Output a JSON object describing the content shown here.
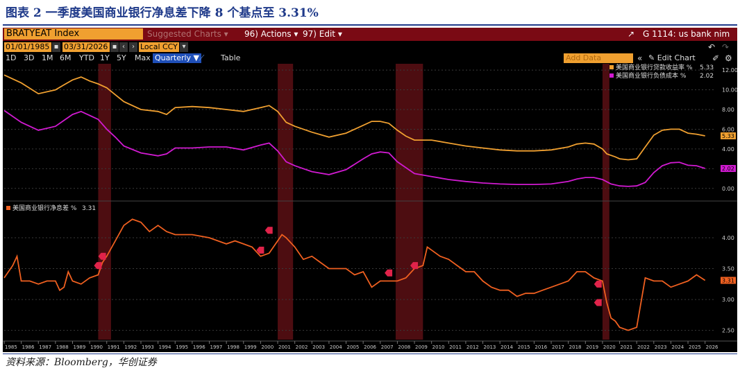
{
  "title": "图表 2  一季度美国商业银行净息差下降 8 个基点至 3.31%",
  "source": "资料来源：Bloomberg，华创证券",
  "terminal": {
    "ticker": "BRATYEAT Index",
    "suggested": "Suggested Charts",
    "actions": "96) Actions",
    "edit": "97) Edit",
    "chart_ref": "G 1114: us bank nim",
    "date_from": "01/01/1985",
    "date_to": "03/31/2026",
    "currency": "Local CCY",
    "periods": [
      "1D",
      "3D",
      "1M",
      "6M",
      "YTD",
      "1Y",
      "5Y",
      "Max"
    ],
    "frequency": "Quarterly",
    "table_label": "Table",
    "add_data": "Add Data",
    "edit_chart": "Edit Chart",
    "colors": {
      "accent": "#f0a030",
      "header": "#7a0a14",
      "freq": "#1f4fb8"
    }
  },
  "chart_data": [
    {
      "type": "line",
      "panel": "upper",
      "ylim": [
        -1.0,
        12.5
      ],
      "yticks": [
        "12.00",
        "10.00",
        "8.00",
        "6.00",
        "4.00",
        "2.00",
        "0.00"
      ],
      "ytick_values": [
        12,
        10,
        8,
        6,
        4,
        2,
        0
      ],
      "series": [
        {
          "name": "美国商业银行贷款收益率 %",
          "last": "5.33",
          "color": "#f0a030",
          "points": [
            [
              1985.0,
              11.5
            ],
            [
              1986.0,
              10.7
            ],
            [
              1987.0,
              9.6
            ],
            [
              1988.0,
              10.0
            ],
            [
              1988.5,
              10.5
            ],
            [
              1989.0,
              11.0
            ],
            [
              1989.5,
              11.3
            ],
            [
              1990.0,
              10.9
            ],
            [
              1990.5,
              10.6
            ],
            [
              1991.0,
              10.2
            ],
            [
              1991.5,
              9.5
            ],
            [
              1992.0,
              8.8
            ],
            [
              1993.0,
              8.0
            ],
            [
              1994.0,
              7.8
            ],
            [
              1994.5,
              7.5
            ],
            [
              1995.0,
              8.2
            ],
            [
              1996.0,
              8.3
            ],
            [
              1997.0,
              8.2
            ],
            [
              1998.0,
              8.0
            ],
            [
              1999.0,
              7.8
            ],
            [
              2000.0,
              8.2
            ],
            [
              2000.5,
              8.4
            ],
            [
              2001.0,
              7.8
            ],
            [
              2001.5,
              6.7
            ],
            [
              2002.0,
              6.3
            ],
            [
              2003.0,
              5.7
            ],
            [
              2004.0,
              5.2
            ],
            [
              2005.0,
              5.6
            ],
            [
              2006.0,
              6.4
            ],
            [
              2006.5,
              6.8
            ],
            [
              2007.0,
              6.8
            ],
            [
              2007.5,
              6.6
            ],
            [
              2008.0,
              5.9
            ],
            [
              2008.5,
              5.3
            ],
            [
              2009.0,
              4.9
            ],
            [
              2010.0,
              4.9
            ],
            [
              2011.0,
              4.6
            ],
            [
              2012.0,
              4.3
            ],
            [
              2013.0,
              4.1
            ],
            [
              2014.0,
              3.9
            ],
            [
              2015.0,
              3.8
            ],
            [
              2016.0,
              3.8
            ],
            [
              2017.0,
              3.9
            ],
            [
              2018.0,
              4.2
            ],
            [
              2018.5,
              4.5
            ],
            [
              2019.0,
              4.6
            ],
            [
              2019.5,
              4.5
            ],
            [
              2020.0,
              4.0
            ],
            [
              2020.25,
              3.5
            ],
            [
              2020.75,
              3.2
            ],
            [
              2021.0,
              3.0
            ],
            [
              2021.5,
              2.9
            ],
            [
              2022.0,
              3.0
            ],
            [
              2022.5,
              4.2
            ],
            [
              2023.0,
              5.4
            ],
            [
              2023.5,
              5.9
            ],
            [
              2024.0,
              6.0
            ],
            [
              2024.5,
              6.0
            ],
            [
              2025.0,
              5.6
            ],
            [
              2025.5,
              5.5
            ],
            [
              2026.0,
              5.33
            ]
          ]
        },
        {
          "name": "美国商业银行负债成本 %",
          "last": "2.02",
          "color": "#d11ad1",
          "points": [
            [
              1985.0,
              7.9
            ],
            [
              1986.0,
              6.7
            ],
            [
              1987.0,
              5.9
            ],
            [
              1988.0,
              6.3
            ],
            [
              1989.0,
              7.5
            ],
            [
              1989.5,
              7.8
            ],
            [
              1990.0,
              7.4
            ],
            [
              1990.5,
              7.0
            ],
            [
              1991.0,
              6.0
            ],
            [
              1991.5,
              5.2
            ],
            [
              1992.0,
              4.3
            ],
            [
              1993.0,
              3.6
            ],
            [
              1994.0,
              3.3
            ],
            [
              1994.5,
              3.5
            ],
            [
              1995.0,
              4.1
            ],
            [
              1996.0,
              4.1
            ],
            [
              1997.0,
              4.2
            ],
            [
              1998.0,
              4.2
            ],
            [
              1999.0,
              3.9
            ],
            [
              2000.0,
              4.4
            ],
            [
              2000.5,
              4.6
            ],
            [
              2001.0,
              3.8
            ],
            [
              2001.5,
              2.7
            ],
            [
              2002.0,
              2.3
            ],
            [
              2003.0,
              1.7
            ],
            [
              2004.0,
              1.4
            ],
            [
              2005.0,
              1.9
            ],
            [
              2006.0,
              3.0
            ],
            [
              2006.5,
              3.5
            ],
            [
              2007.0,
              3.7
            ],
            [
              2007.5,
              3.6
            ],
            [
              2008.0,
              2.7
            ],
            [
              2008.5,
              2.1
            ],
            [
              2009.0,
              1.5
            ],
            [
              2010.0,
              1.2
            ],
            [
              2011.0,
              0.9
            ],
            [
              2012.0,
              0.7
            ],
            [
              2013.0,
              0.55
            ],
            [
              2014.0,
              0.45
            ],
            [
              2015.0,
              0.4
            ],
            [
              2016.0,
              0.4
            ],
            [
              2017.0,
              0.45
            ],
            [
              2018.0,
              0.7
            ],
            [
              2018.5,
              0.95
            ],
            [
              2019.0,
              1.1
            ],
            [
              2019.5,
              1.1
            ],
            [
              2020.0,
              0.9
            ],
            [
              2020.5,
              0.45
            ],
            [
              2021.0,
              0.25
            ],
            [
              2021.5,
              0.2
            ],
            [
              2022.0,
              0.25
            ],
            [
              2022.5,
              0.6
            ],
            [
              2023.0,
              1.6
            ],
            [
              2023.5,
              2.3
            ],
            [
              2024.0,
              2.6
            ],
            [
              2024.5,
              2.65
            ],
            [
              2025.0,
              2.35
            ],
            [
              2025.5,
              2.3
            ],
            [
              2026.0,
              2.02
            ]
          ]
        }
      ]
    },
    {
      "type": "line",
      "panel": "lower",
      "ylim": [
        2.35,
        4.55
      ],
      "yticks": [
        "4.00",
        "3.50",
        "3.00",
        "2.50"
      ],
      "ytick_values": [
        4.0,
        3.5,
        3.0,
        2.5
      ],
      "series": [
        {
          "name": "美国商业银行净息差 %",
          "last": "3.31",
          "color": "#f06020",
          "points": [
            [
              1985.0,
              3.35
            ],
            [
              1985.5,
              3.55
            ],
            [
              1985.75,
              3.7
            ],
            [
              1986.0,
              3.3
            ],
            [
              1986.5,
              3.3
            ],
            [
              1987.0,
              3.25
            ],
            [
              1987.5,
              3.3
            ],
            [
              1988.0,
              3.3
            ],
            [
              1988.25,
              3.15
            ],
            [
              1988.5,
              3.2
            ],
            [
              1988.75,
              3.45
            ],
            [
              1989.0,
              3.3
            ],
            [
              1989.5,
              3.25
            ],
            [
              1990.0,
              3.35
            ],
            [
              1990.5,
              3.4
            ],
            [
              1990.75,
              3.6
            ],
            [
              1991.0,
              3.7
            ],
            [
              1991.5,
              3.95
            ],
            [
              1992.0,
              4.2
            ],
            [
              1992.5,
              4.3
            ],
            [
              1993.0,
              4.25
            ],
            [
              1993.5,
              4.1
            ],
            [
              1994.0,
              4.2
            ],
            [
              1994.5,
              4.1
            ],
            [
              1995.0,
              4.05
            ],
            [
              1996.0,
              4.05
            ],
            [
              1997.0,
              4.0
            ],
            [
              1998.0,
              3.9
            ],
            [
              1998.5,
              3.95
            ],
            [
              1999.0,
              3.9
            ],
            [
              1999.5,
              3.85
            ],
            [
              2000.0,
              3.7
            ],
            [
              2000.5,
              3.75
            ],
            [
              2001.0,
              3.95
            ],
            [
              2001.25,
              4.05
            ],
            [
              2001.5,
              4.0
            ],
            [
              2002.0,
              3.85
            ],
            [
              2002.5,
              3.65
            ],
            [
              2003.0,
              3.7
            ],
            [
              2003.5,
              3.6
            ],
            [
              2004.0,
              3.5
            ],
            [
              2004.5,
              3.5
            ],
            [
              2005.0,
              3.5
            ],
            [
              2005.5,
              3.4
            ],
            [
              2006.0,
              3.45
            ],
            [
              2006.5,
              3.2
            ],
            [
              2007.0,
              3.3
            ],
            [
              2007.5,
              3.3
            ],
            [
              2008.0,
              3.3
            ],
            [
              2008.5,
              3.35
            ],
            [
              2009.0,
              3.5
            ],
            [
              2009.5,
              3.55
            ],
            [
              2009.75,
              3.85
            ],
            [
              2010.0,
              3.8
            ],
            [
              2010.5,
              3.7
            ],
            [
              2011.0,
              3.65
            ],
            [
              2011.5,
              3.55
            ],
            [
              2012.0,
              3.45
            ],
            [
              2012.5,
              3.45
            ],
            [
              2013.0,
              3.3
            ],
            [
              2013.5,
              3.2
            ],
            [
              2014.0,
              3.15
            ],
            [
              2014.5,
              3.15
            ],
            [
              2015.0,
              3.05
            ],
            [
              2015.5,
              3.1
            ],
            [
              2016.0,
              3.1
            ],
            [
              2016.5,
              3.15
            ],
            [
              2017.0,
              3.2
            ],
            [
              2017.5,
              3.25
            ],
            [
              2018.0,
              3.3
            ],
            [
              2018.5,
              3.45
            ],
            [
              2019.0,
              3.45
            ],
            [
              2019.5,
              3.35
            ],
            [
              2020.0,
              3.3
            ],
            [
              2020.25,
              2.95
            ],
            [
              2020.5,
              2.7
            ],
            [
              2020.75,
              2.65
            ],
            [
              2021.0,
              2.55
            ],
            [
              2021.5,
              2.5
            ],
            [
              2022.0,
              2.55
            ],
            [
              2022.5,
              3.35
            ],
            [
              2023.0,
              3.3
            ],
            [
              2023.5,
              3.3
            ],
            [
              2024.0,
              3.2
            ],
            [
              2024.5,
              3.25
            ],
            [
              2025.0,
              3.3
            ],
            [
              2025.5,
              3.4
            ],
            [
              2026.0,
              3.31
            ]
          ]
        }
      ],
      "markers": [
        [
          1990.5,
          3.55
        ],
        [
          1990.75,
          3.7
        ],
        [
          2000.0,
          3.8
        ],
        [
          2000.5,
          4.12
        ],
        [
          2007.5,
          3.43
        ],
        [
          2009.0,
          3.55
        ],
        [
          2019.75,
          3.25
        ],
        [
          2019.75,
          2.95
        ]
      ]
    }
  ],
  "recessions": [
    [
      1990.5,
      1991.25
    ],
    [
      2001.0,
      2001.9
    ],
    [
      2007.9,
      2009.5
    ],
    [
      2020.0,
      2020.4
    ]
  ],
  "x_range": [
    1985,
    2026.5
  ],
  "x_tick_labels": [
    "1985",
    "1986",
    "1987",
    "1988",
    "1989",
    "1990",
    "1991",
    "1992",
    "1993",
    "1994",
    "1995",
    "1996",
    "1997",
    "1998",
    "1999",
    "2000",
    "2001",
    "2002",
    "2003",
    "2004",
    "2005",
    "2006",
    "2007",
    "2008",
    "2009",
    "2010",
    "2011",
    "2012",
    "2013",
    "2014",
    "2015",
    "2016",
    "2017",
    "2018",
    "2019",
    "2020",
    "2021",
    "2022",
    "2023",
    "2024",
    "2025",
    "2026"
  ]
}
